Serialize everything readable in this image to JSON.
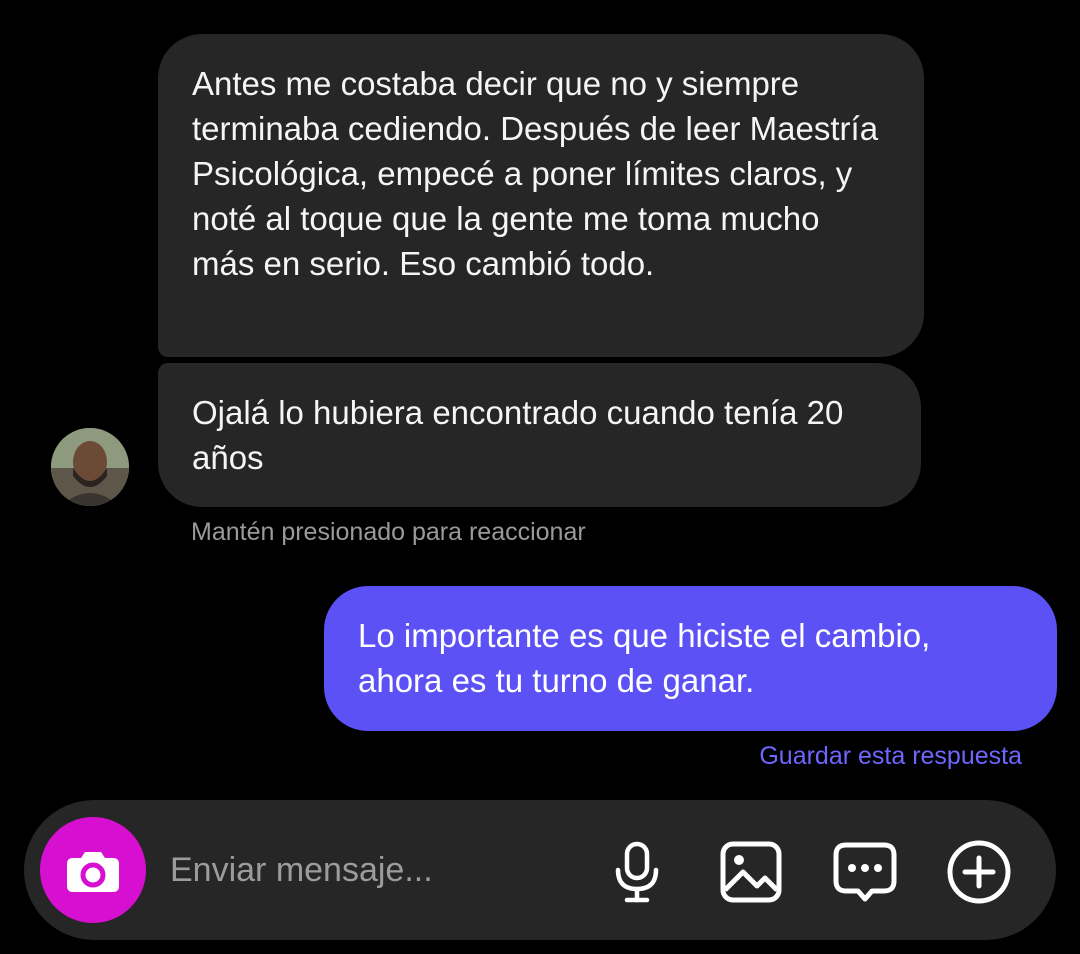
{
  "messages": {
    "received": [
      "Antes me costaba decir que no y siempre terminaba cediendo. Después de leer Maestría Psicológica, empecé a poner límites claros, y noté al toque que la gente me toma mucho más en serio. Eso cambió todo.",
      "Ojalá lo hubiera encontrado cuando tenía 20 años"
    ],
    "reaction_hint": "Mantén presionado para reaccionar",
    "sent": "Lo importante es que hiciste el cambio, ahora es tu turno de ganar.",
    "save_reply_label": "Guardar esta respuesta"
  },
  "composer": {
    "placeholder": "Enviar mensaje...",
    "icons": [
      "camera-icon",
      "microphone-icon",
      "image-icon",
      "sticker-chat-icon",
      "plus-circle-icon"
    ]
  },
  "colors": {
    "background": "#000000",
    "received_bubble": "#262626",
    "sent_bubble": "#5b51f5",
    "save_link": "#6f66ff",
    "camera_button": "#d60fd1",
    "composer_bar": "#262626"
  }
}
